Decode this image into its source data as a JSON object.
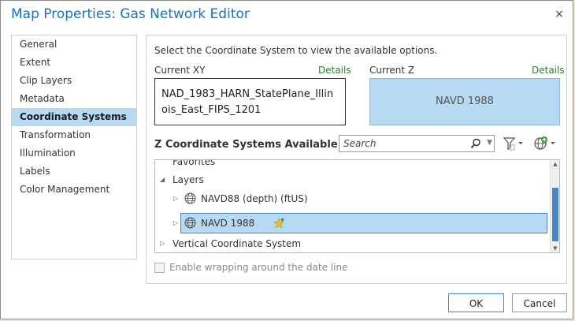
{
  "window": {
    "title": "Map Properties: Gas Network Editor",
    "close_icon": "×"
  },
  "nav": {
    "items": [
      {
        "label": "General"
      },
      {
        "label": "Extent"
      },
      {
        "label": "Clip Layers"
      },
      {
        "label": "Metadata"
      },
      {
        "label": "Coordinate Systems",
        "active": true
      },
      {
        "label": "Transformation"
      },
      {
        "label": "Illumination"
      },
      {
        "label": "Labels"
      },
      {
        "label": "Color Management"
      }
    ]
  },
  "content": {
    "intro": "Select the Coordinate System to view the available options.",
    "current_xy": {
      "label": "Current XY",
      "details": "Details",
      "value": "NAD_1983_HARN_StatePlane_Illinois_East_FIPS_1201"
    },
    "current_z": {
      "label": "Current Z",
      "details": "Details",
      "value": "NAVD 1988"
    },
    "section_title": "Z Coordinate Systems Available",
    "search": {
      "placeholder": "Search"
    },
    "tree": {
      "favorites": "Favorites",
      "layers": "Layers",
      "layer_items": [
        "NAVD88 (depth) (ftUS)",
        "NAVD 1988"
      ],
      "vertical": "Vertical Coordinate System"
    },
    "wrap_label": "Enable wrapping around the date line"
  },
  "buttons": {
    "ok": "OK",
    "cancel": "Cancel"
  },
  "colors": {
    "accent": "#1c6fb8",
    "selection": "#b7d9f2",
    "details_link": "#2e7d32",
    "favorite_star": "#e8c21a"
  }
}
